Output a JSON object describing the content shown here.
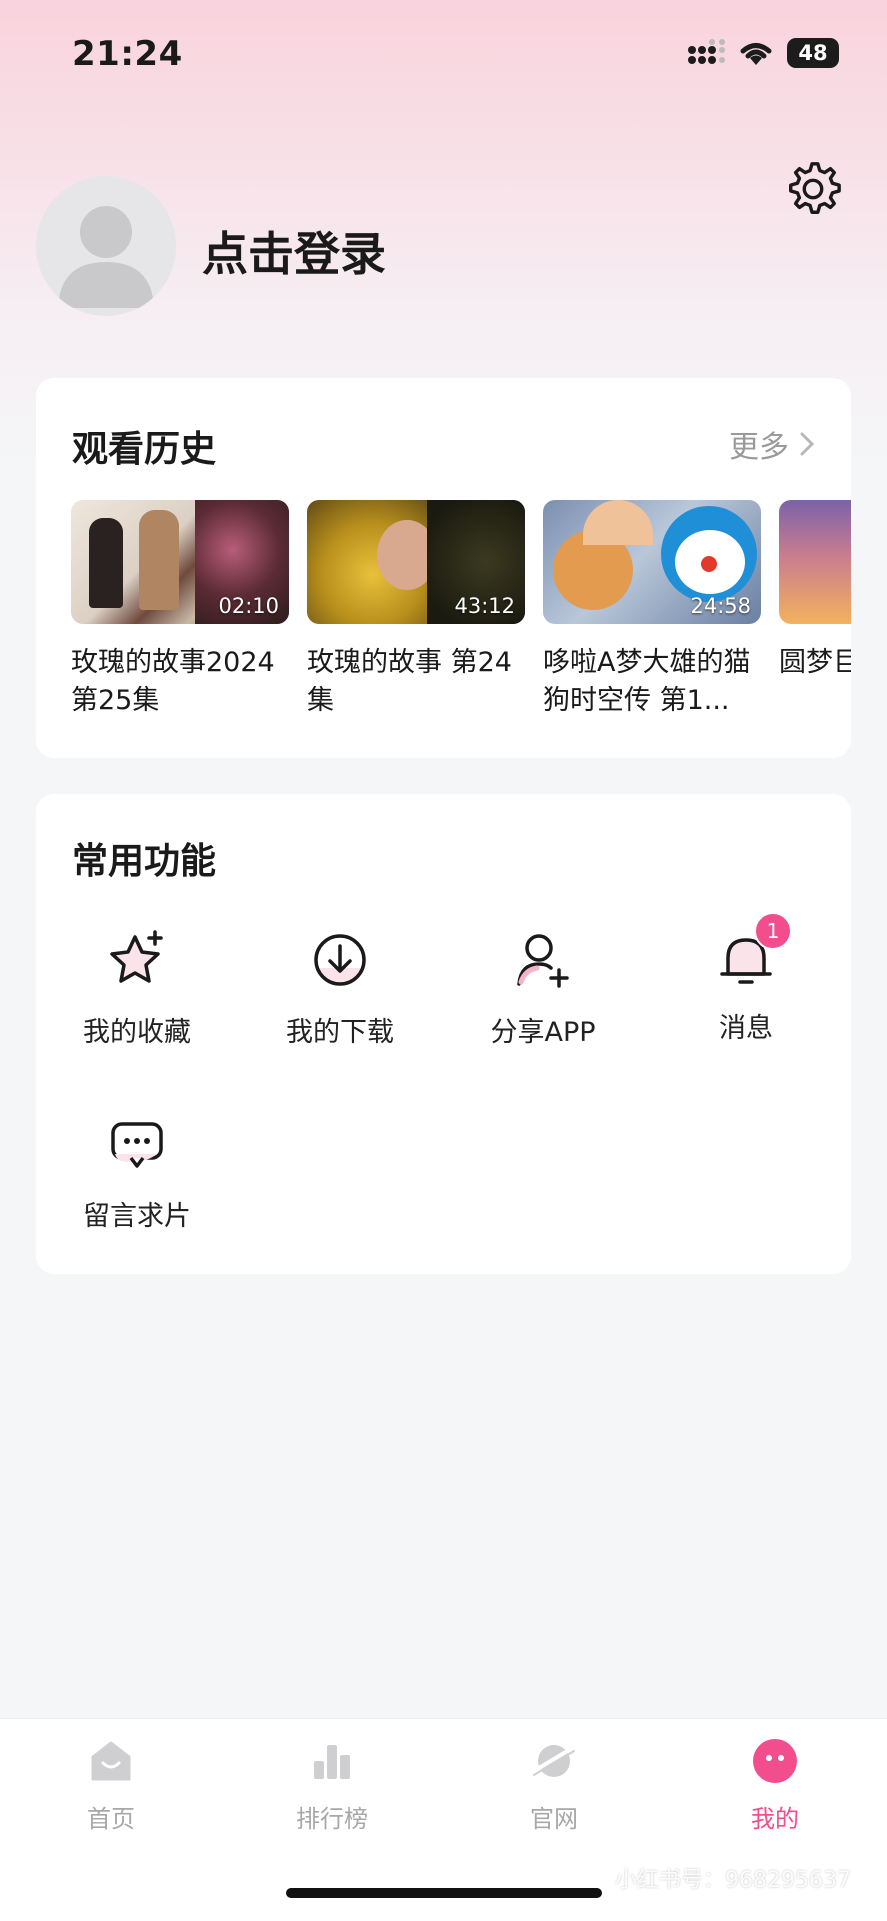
{
  "status_bar": {
    "time": "21:24",
    "battery": "48"
  },
  "profile": {
    "login_text": "点击登录"
  },
  "history": {
    "title": "观看历史",
    "more_label": "更多",
    "items": [
      {
        "title": "玫瑰的故事2024 第25集",
        "duration": "02:10"
      },
      {
        "title": "玫瑰的故事 第24集",
        "duration": "43:12"
      },
      {
        "title": "哆啦A梦大雄的猫狗时空传 第1...",
        "duration": "24:58"
      },
      {
        "title": "圆梦巨人",
        "duration": ""
      }
    ]
  },
  "functions": {
    "title": "常用功能",
    "items": [
      {
        "label": "我的收藏",
        "icon": "star-icon"
      },
      {
        "label": "我的下载",
        "icon": "download-icon"
      },
      {
        "label": "分享APP",
        "icon": "add-user-icon"
      },
      {
        "label": "消息",
        "icon": "bell-icon",
        "badge": "1"
      },
      {
        "label": "留言求片",
        "icon": "chat-icon"
      }
    ]
  },
  "tabbar": {
    "items": [
      {
        "label": "首页",
        "icon": "home-icon",
        "active": false
      },
      {
        "label": "排行榜",
        "icon": "ranking-icon",
        "active": false
      },
      {
        "label": "官网",
        "icon": "planet-icon",
        "active": false
      },
      {
        "label": "我的",
        "icon": "profile-icon",
        "active": true
      }
    ]
  },
  "watermark": "小红书号：968295637",
  "colors": {
    "accent": "#f24e8d",
    "background": "#f5f6f8",
    "inactive": "#a8a8a8"
  }
}
